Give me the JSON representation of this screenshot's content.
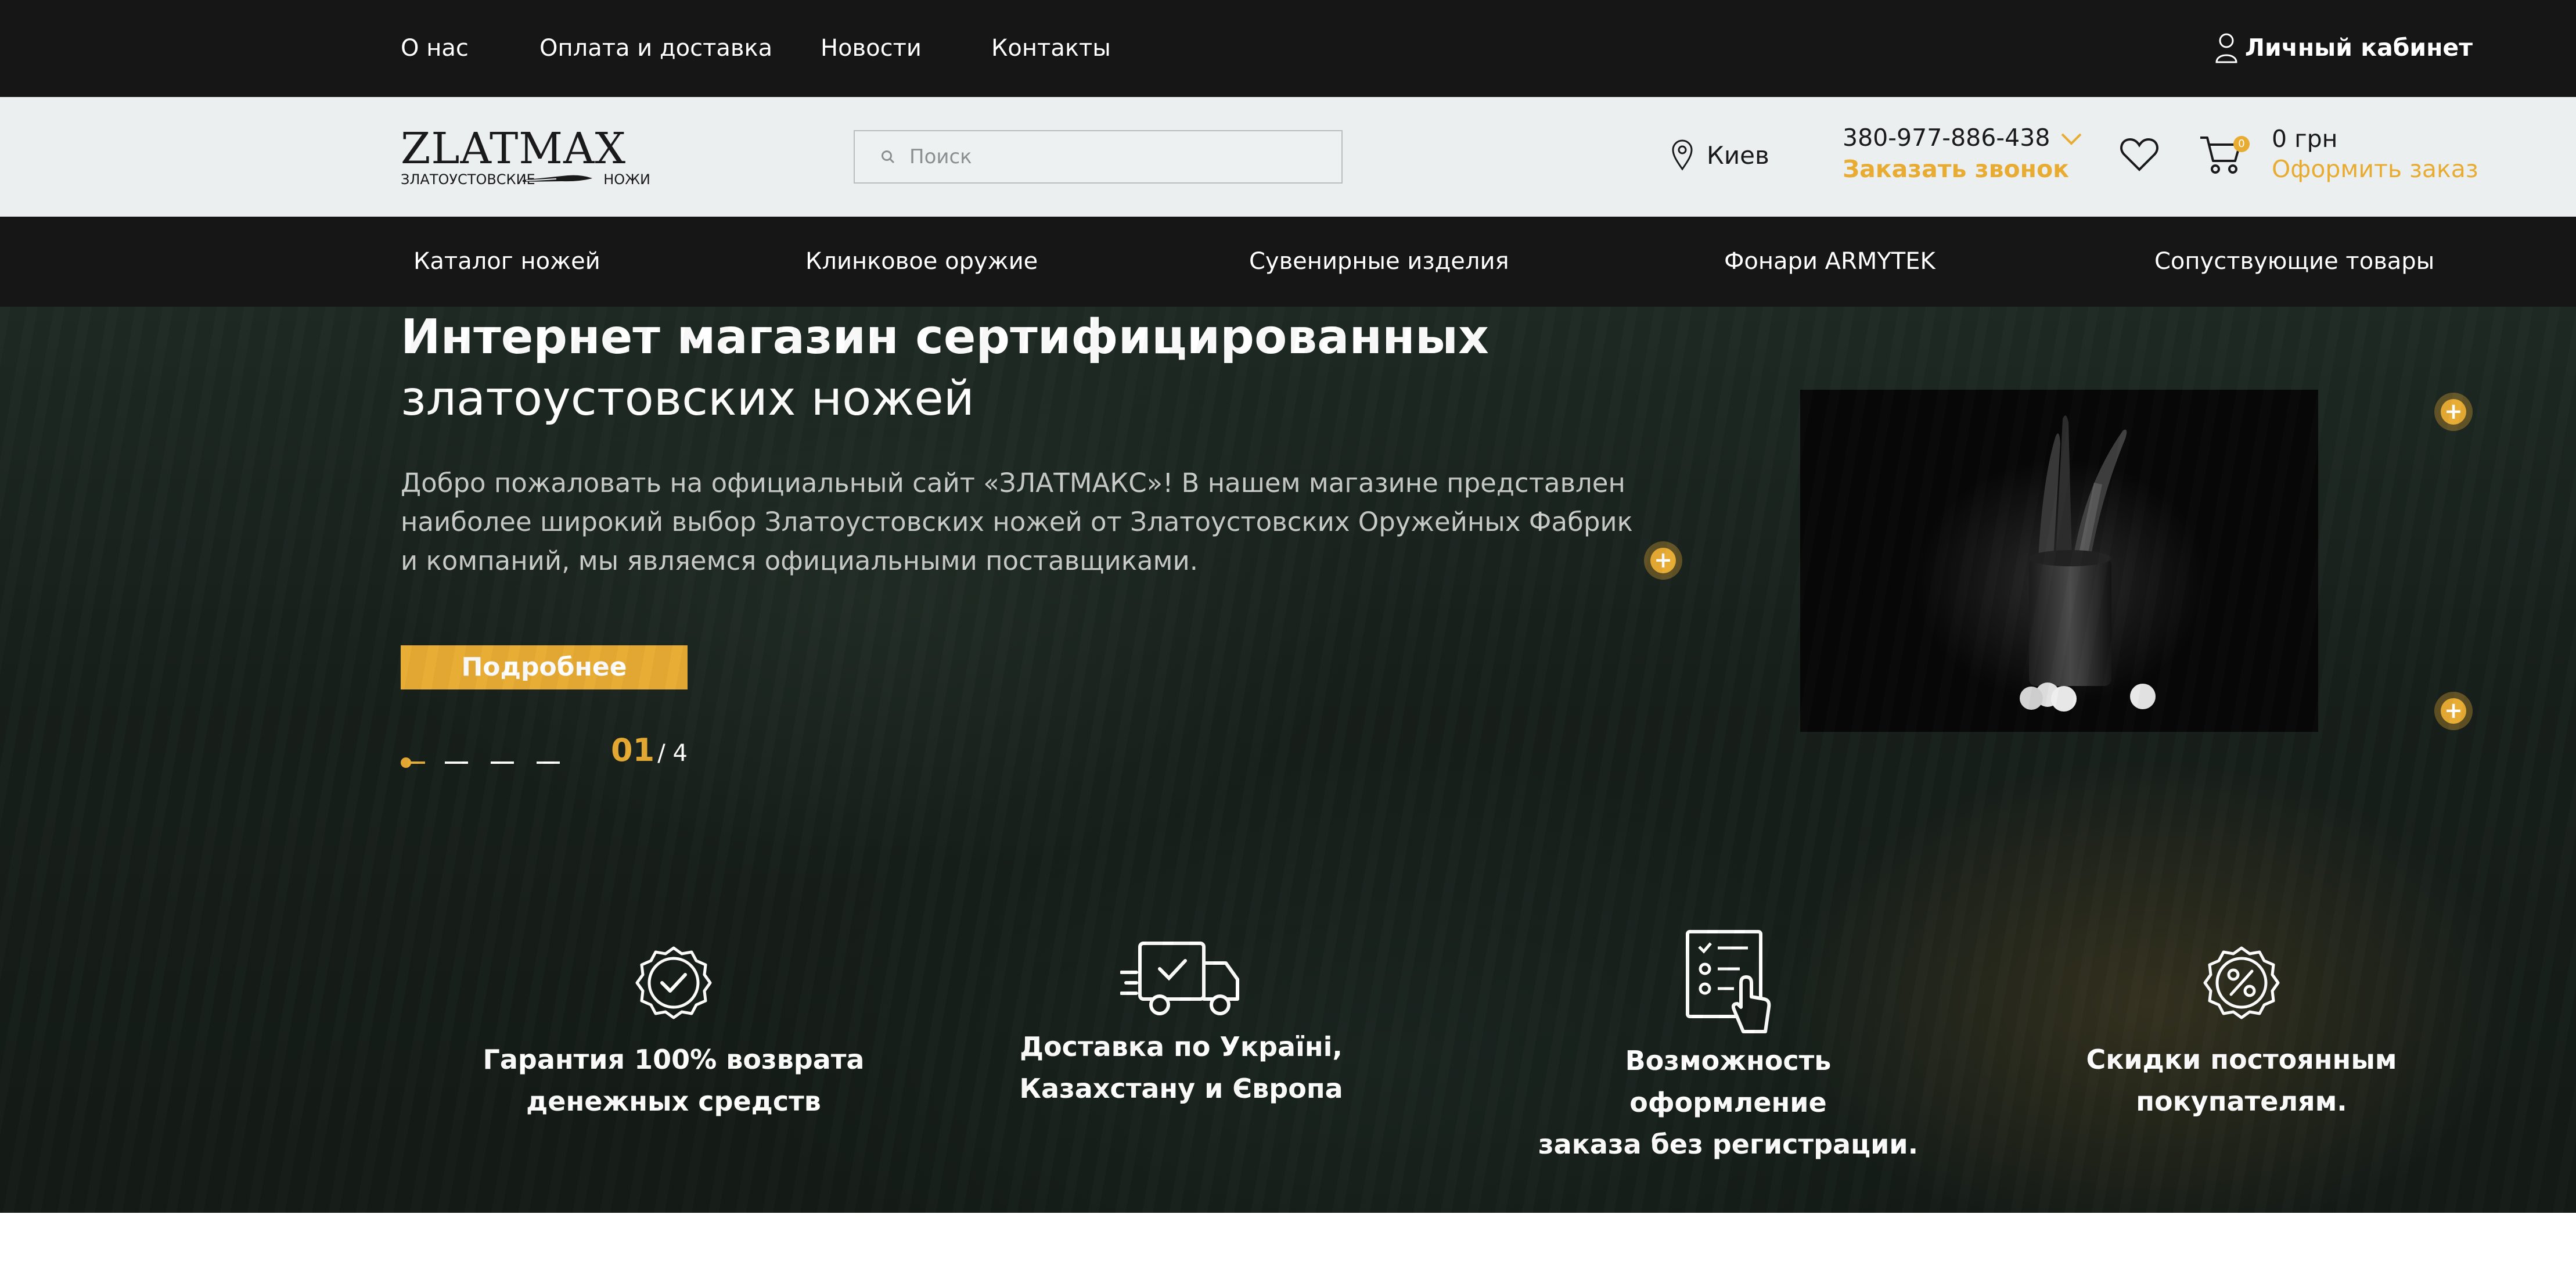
{
  "topbar": {
    "links": [
      "О нас",
      "Оплата и доставка",
      "Новости",
      "Контакты"
    ],
    "account_label": "Личный кабинет"
  },
  "header": {
    "logo_word": "ZLATMAX",
    "logo_sub_left": "ЗЛАТОУСТОВСКИЕ",
    "logo_sub_right": "НОЖИ",
    "search_placeholder": "Поиск",
    "city": "Киев",
    "phone": "380-977-886-438",
    "callback_label": "Заказать звонок",
    "cart_count": "0",
    "cart_total": "0 грн",
    "checkout_label": "Оформить заказ"
  },
  "nav": {
    "items": [
      "Каталог ножей",
      "Клинковое оружие",
      "Сувенирные изделия",
      "Фонари ARMYTEK",
      "Сопуствующие товары"
    ]
  },
  "hero": {
    "title_bold": "Интернет магазин сертифицированных",
    "title_regular": "златоустовских ножей",
    "text": "Добро пожаловать на официальный сайт «ЗЛАТМАКС»! В нашем магазине представлен наиболее широкий выбор Златоустовских ножей от Златоустовских Оружейных Фабрик и компаний, мы являемся официальными поставщиками.",
    "button_label": "Подробнее",
    "slide_current": "01",
    "slide_total": "/ 4"
  },
  "features": [
    {
      "icon": "guarantee-icon",
      "line1": "Гарантия 100% возврата",
      "line2": "денежных средств"
    },
    {
      "icon": "delivery-truck-icon",
      "line1": "Доставка по Україні,",
      "line2": "Казахстану и Європа"
    },
    {
      "icon": "checklist-click-icon",
      "line1": "Возможность оформление",
      "line2": "заказа без регистрации."
    },
    {
      "icon": "discount-badge-icon",
      "line1": "Скидки постоянным",
      "line2": "покупателям."
    }
  ],
  "colors": {
    "accent": "#e8ac33",
    "dark_bar": "#161616",
    "header_bg": "#ebeff0"
  }
}
